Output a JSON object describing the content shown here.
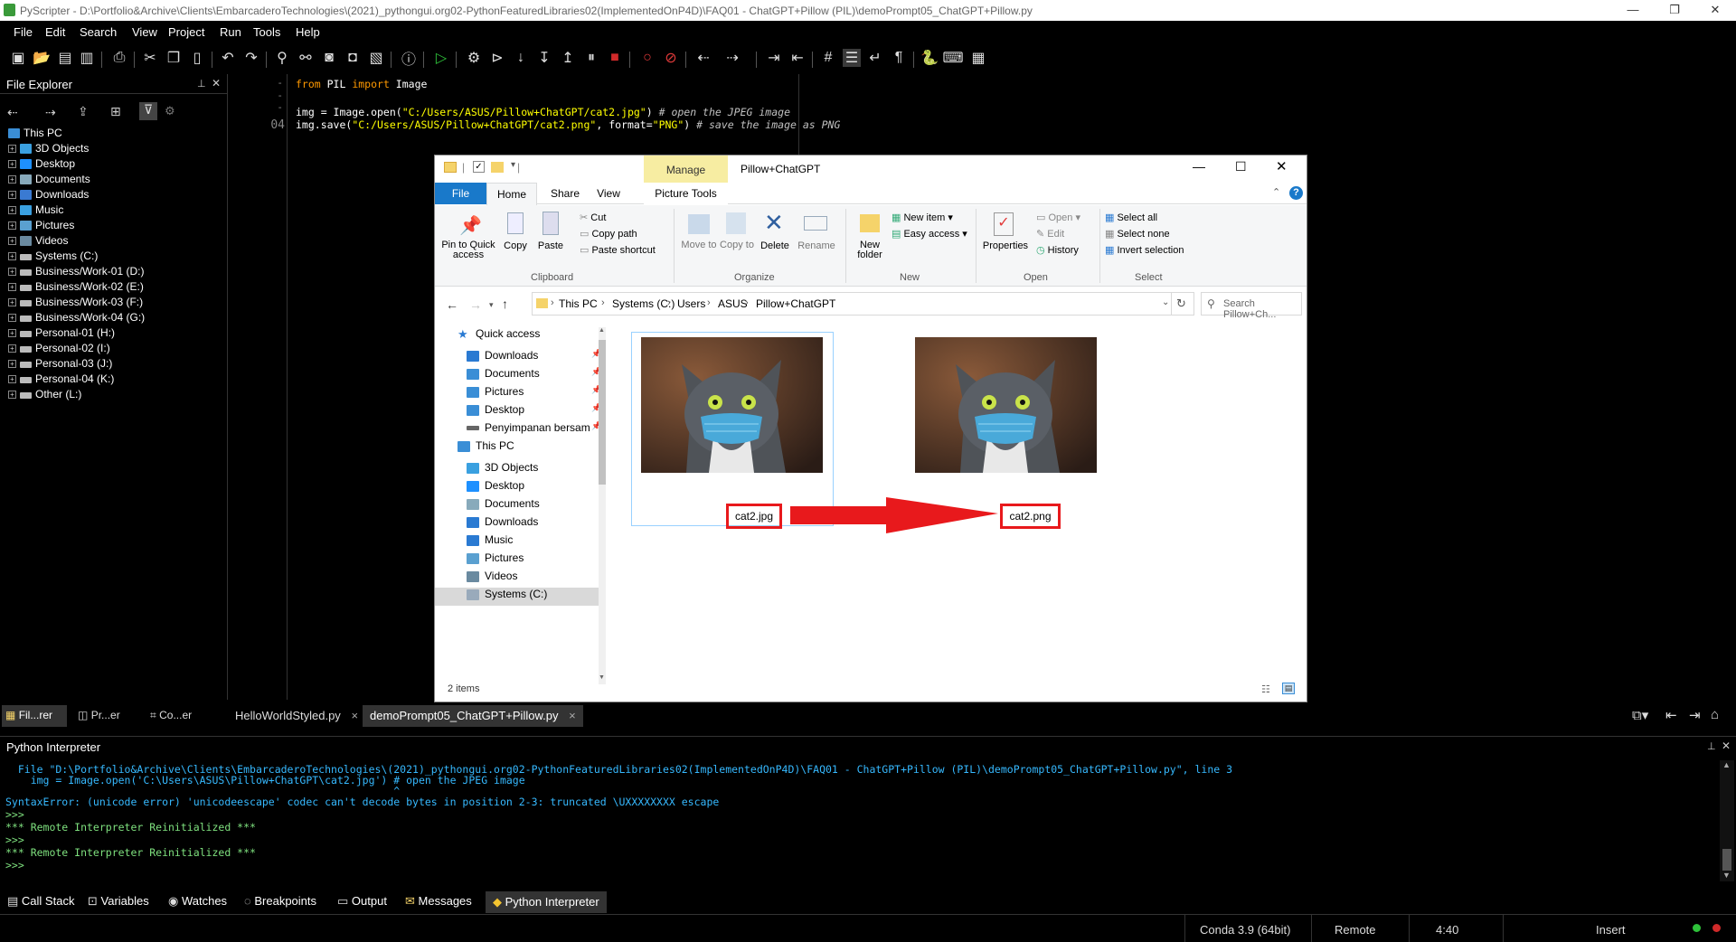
{
  "window": {
    "title": "PyScripter - D:\\Portfolio&Archive\\Clients\\EmbarcaderoTechnologies\\(2021)_pythongui.org02-PythonFeaturedLibraries02(ImplementedOnP4D)\\FAQ01 - ChatGPT+Pillow (PIL)\\demoPrompt05_ChatGPT+Pillow.py",
    "minimize": "—",
    "restore": "❐",
    "close": "✕"
  },
  "menu": [
    "File",
    "Edit",
    "Search",
    "View",
    "Project",
    "Run",
    "Tools",
    "Help"
  ],
  "file_explorer": {
    "title": "File Explorer",
    "root": "This PC",
    "items": [
      "3D Objects",
      "Desktop",
      "Documents",
      "Downloads",
      "Music",
      "Pictures",
      "Videos",
      "Systems (C:)",
      "Business/Work-01 (D:)",
      "Business/Work-02 (E:)",
      "Business/Work-03 (F:)",
      "Business/Work-04 (G:)",
      "Personal-01 (H:)",
      "Personal-02 (I:)",
      "Personal-03 (J:)",
      "Personal-04 (K:)",
      "Other (L:)"
    ]
  },
  "editor": {
    "gutter": [
      "-",
      "-",
      "-",
      "04"
    ],
    "lines": [
      {
        "kw1": "from",
        "mod": " PIL ",
        "kw2": "import",
        "rest": " Image"
      },
      {
        "text": ""
      },
      {
        "code": "img = Image.open(",
        "str": "\"C:/Users/ASUS/Pillow+ChatGPT/cat2.jpg\"",
        "tail": ") ",
        "comment": "# open the JPEG image"
      },
      {
        "code": "img.save(",
        "str": "\"C:/Users/ASUS/Pillow+ChatGPT/cat2.png\"",
        "mid": ", format=",
        "str2": "\"PNG\"",
        "tail": ") ",
        "comment": "# save the image as PNG"
      }
    ]
  },
  "explorer": {
    "title": "Pillow+ChatGPT",
    "manage": "Manage",
    "picture_tools": "Picture Tools",
    "tabs": [
      "File",
      "Home",
      "Share",
      "View"
    ],
    "ribbon": {
      "clipboard": {
        "group": "Clipboard",
        "pin": "Pin to Quick access",
        "copy": "Copy",
        "paste": "Paste",
        "cut": "Cut",
        "copy_path": "Copy path",
        "paste_shortcut": "Paste shortcut"
      },
      "organize": {
        "group": "Organize",
        "move_to": "Move to",
        "copy_to": "Copy to",
        "delete": "Delete",
        "rename": "Rename"
      },
      "new": {
        "group": "New",
        "new_folder": "New folder",
        "new_item": "New item",
        "easy_access": "Easy access"
      },
      "open": {
        "group": "Open",
        "properties": "Properties",
        "open": "Open",
        "edit": "Edit",
        "history": "History"
      },
      "select": {
        "group": "Select",
        "select_all": "Select all",
        "select_none": "Select none",
        "invert": "Invert selection"
      }
    },
    "breadcrumb": [
      "This PC",
      "Systems (C:)",
      "Users",
      "ASUS",
      "Pillow+ChatGPT"
    ],
    "search_placeholder": "Search Pillow+Ch...",
    "nav": {
      "quick_access": "Quick access",
      "quick_items": [
        "Downloads",
        "Documents",
        "Pictures",
        "Desktop",
        "Penyimpanan bersam"
      ],
      "this_pc": "This PC",
      "pc_items": [
        "3D Objects",
        "Desktop",
        "Documents",
        "Downloads",
        "Music",
        "Pictures",
        "Videos",
        "Systems (C:)"
      ]
    },
    "files": [
      {
        "name": "cat2.jpg"
      },
      {
        "name": "cat2.png"
      }
    ],
    "status": "2 items"
  },
  "editor_tabs": {
    "left_tabs": [
      "Fil...rer",
      "Pr...er",
      "Co...er"
    ],
    "files": [
      "HelloWorldStyled.py",
      "demoPrompt05_ChatGPT+Pillow.py"
    ],
    "close": "×"
  },
  "interpreter": {
    "title": "Python Interpreter",
    "lines": [
      {
        "t": "  File \"D:\\Portfolio&Archive\\Clients\\EmbarcaderoTechnologies\\(2021)_pythongui.org02-PythonFeaturedLibraries02(ImplementedOnP4D)\\FAQ01 - ChatGPT+Pillow (PIL)\\demoPrompt05_ChatGPT+Pillow.py\", line 3",
        "c": "#36b9ff"
      },
      {
        "t": "    img = Image.open('C:\\Users\\ASUS\\Pillow+ChatGPT\\cat2.jpg') # open the JPEG image",
        "c": "#36b9ff"
      },
      {
        "t": "                                                              ^",
        "c": "#36b9ff"
      },
      {
        "t": "SyntaxError: (unicode error) 'unicodeescape' codec can't decode bytes in position 2-3: truncated \\UXXXXXXXX escape",
        "c": "#36b9ff"
      },
      {
        "t": ">>>",
        "c": "#7ee07e"
      },
      {
        "t": "*** Remote Interpreter Reinitialized ***",
        "c": "#7ee07e"
      },
      {
        "t": ">>>",
        "c": "#7ee07e"
      },
      {
        "t": "*** Remote Interpreter Reinitialized ***",
        "c": "#7ee07e"
      },
      {
        "t": ">>>",
        "c": "#7ee07e"
      }
    ]
  },
  "bottom_tabs": [
    "Call Stack",
    "Variables",
    "Watches",
    "Breakpoints",
    "Output",
    "Messages",
    "Python Interpreter"
  ],
  "status": {
    "env": "Conda 3.9 (64bit)",
    "mode": "Remote",
    "pos": "4:40",
    "insert": "Insert"
  },
  "colors": {
    "keyword": "#ff9900",
    "string": "#ffff00",
    "comment": "#c0c0c0",
    "accent": "#1979ca",
    "arrow": "#e8191c"
  }
}
